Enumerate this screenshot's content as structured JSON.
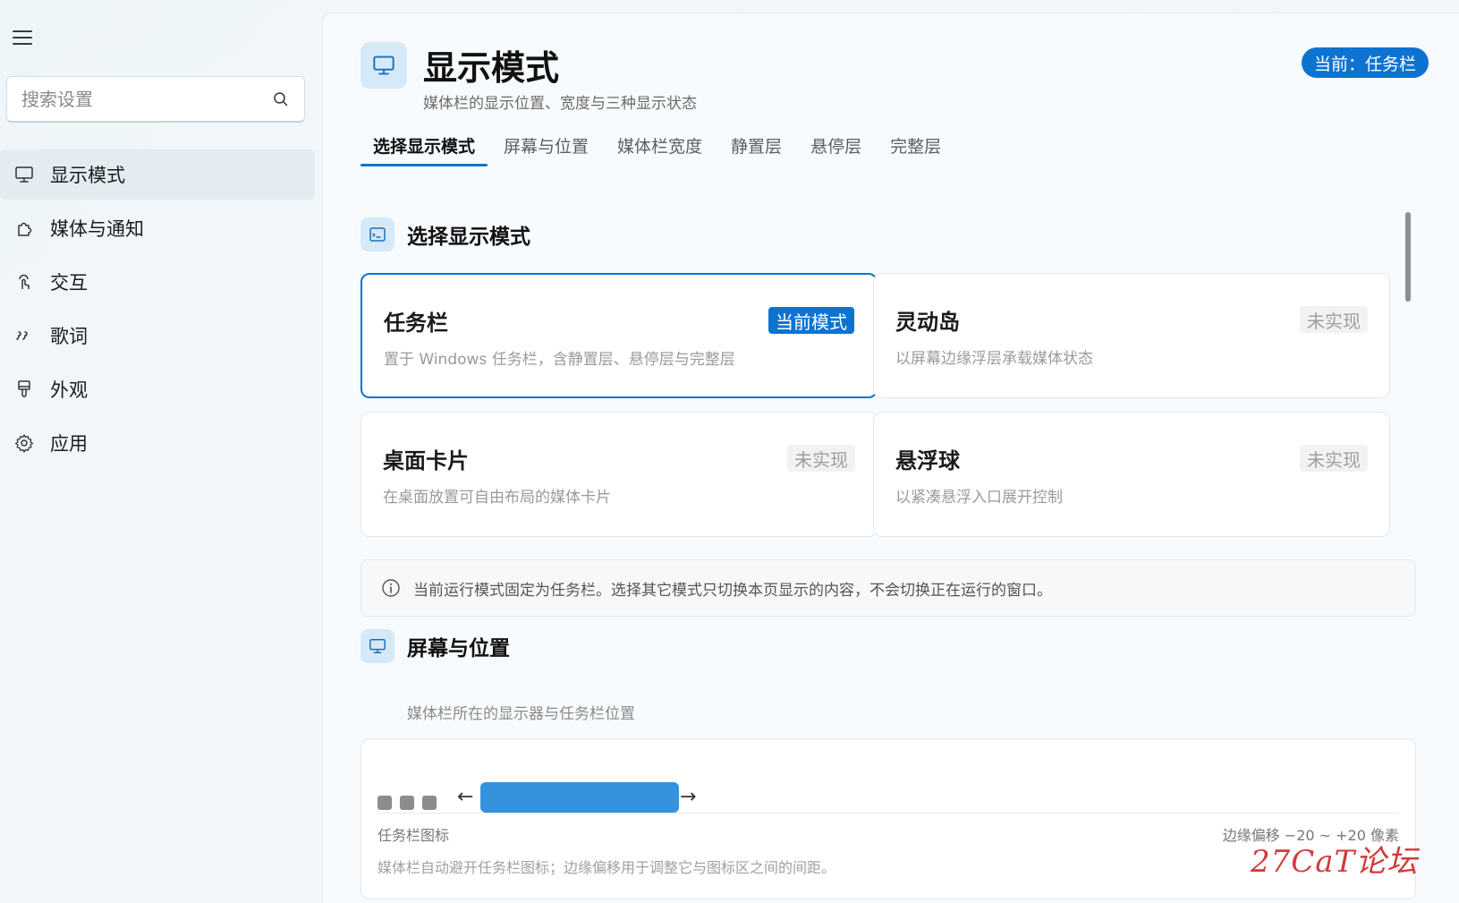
{
  "sidebar": {
    "search": {
      "placeholder": "搜索设置",
      "value": ""
    },
    "items": [
      {
        "label": "显示模式",
        "icon": "monitor-icon",
        "active": true
      },
      {
        "label": "媒体与通知",
        "icon": "puzzle-icon",
        "active": false
      },
      {
        "label": "交互",
        "icon": "touch-icon",
        "active": false
      },
      {
        "label": "歌词",
        "icon": "quote-icon",
        "active": false
      },
      {
        "label": "外观",
        "icon": "brush-icon",
        "active": false
      },
      {
        "label": "应用",
        "icon": "gear-icon",
        "active": false
      }
    ]
  },
  "header": {
    "title": "显示模式",
    "subtitle": "媒体栏的显示位置、宽度与三种显示状态",
    "status_badge": "当前：任务栏"
  },
  "tabs": [
    {
      "label": "选择显示模式",
      "active": true
    },
    {
      "label": "屏幕与位置",
      "active": false
    },
    {
      "label": "媒体栏宽度",
      "active": false
    },
    {
      "label": "静置层",
      "active": false
    },
    {
      "label": "悬停层",
      "active": false
    },
    {
      "label": "完整层",
      "active": false
    }
  ],
  "mode_section": {
    "title": "选择显示模式",
    "cards": [
      {
        "title": "任务栏",
        "desc": "置于 Windows 任务栏，含静置层、悬停层与完整层",
        "badge": "当前模式",
        "selected": true
      },
      {
        "title": "灵动岛",
        "desc": "以屏幕边缘浮层承载媒体状态",
        "badge": "未实现",
        "selected": false
      },
      {
        "title": "桌面卡片",
        "desc": "在桌面放置可自由布局的媒体卡片",
        "badge": "未实现",
        "selected": false
      },
      {
        "title": "悬浮球",
        "desc": "以紧凑悬浮入口展开控制",
        "badge": "未实现",
        "selected": false
      }
    ],
    "info": "当前运行模式固定为任务栏。选择其它模式只切换本页显示的内容，不会切换正在运行的窗口。"
  },
  "screen_section": {
    "title": "屏幕与位置",
    "desc": "媒体栏所在的显示器与任务栏位置",
    "preview": {
      "left_arrow": "←",
      "right_arrow": "→",
      "label_left": "任务栏图标",
      "label_right": "边缘偏移 −20 ~ +20 像素",
      "note": "媒体栏自动避开任务栏图标；边缘偏移用于调整它与图标区之间的间距。"
    }
  },
  "watermark": "27CaT论坛",
  "colors": {
    "accent": "#0d73d1",
    "media_bar": "#3592de",
    "icon_bg": "#d6e9f7"
  }
}
